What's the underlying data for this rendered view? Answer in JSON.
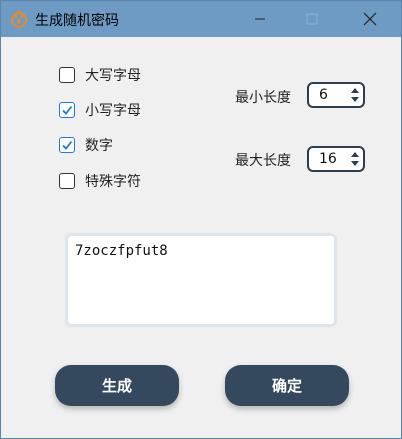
{
  "window": {
    "title": "生成随机密码",
    "titlebar_color": "#6d9bc3"
  },
  "options": [
    {
      "label": "大写字母",
      "checked": false
    },
    {
      "label": "小写字母",
      "checked": true
    },
    {
      "label": "数字",
      "checked": true
    },
    {
      "label": "特殊字符",
      "checked": false
    }
  ],
  "length": {
    "min_label": "最小长度",
    "min_value": "6",
    "max_label": "最大长度",
    "max_value": "16"
  },
  "output": {
    "password": "7zoczfpfut8"
  },
  "buttons": {
    "generate": "生成",
    "confirm": "确定",
    "color": "#34485e"
  },
  "accent_color": "#1e7ad6"
}
